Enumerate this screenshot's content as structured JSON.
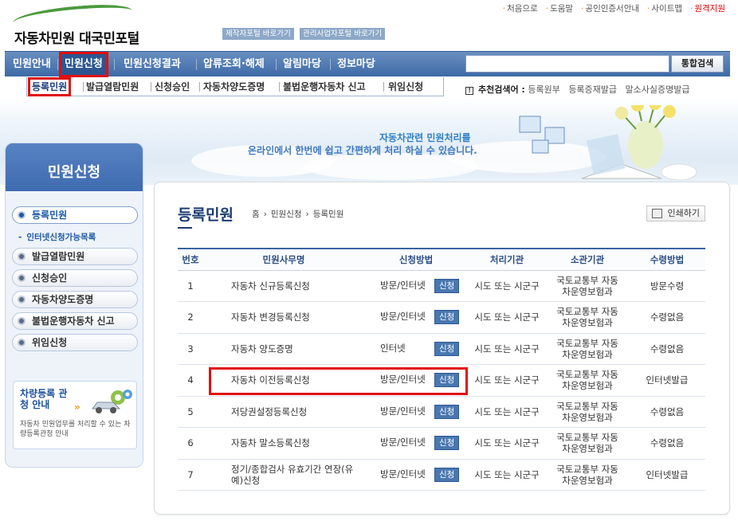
{
  "header": {
    "logo_text": "자동차민원 대국민포털",
    "quick_links": [
      "제작자포털 바로가기",
      "관리사업자포털 바로가기"
    ],
    "util_links": [
      "처음으로",
      "도움말",
      "공인인증서안내",
      "사이트맵",
      "원격지원"
    ]
  },
  "gnb": {
    "items": [
      "민원안내",
      "민원신청",
      "민원신청결과",
      "압류조회·해제",
      "알림마당",
      "정보마당"
    ],
    "search_placeholder": "",
    "search_button": "통합검색"
  },
  "lnb": {
    "items": [
      "등록민원",
      "발급열람민원",
      "신청승인",
      "자동차양도증명",
      "불법운행자동차 신고",
      "위임신청"
    ]
  },
  "recommend": {
    "label": "추천검색어 :",
    "keywords": [
      "등록원부",
      "등록증재발급",
      "말소사실증명발급"
    ]
  },
  "banner": {
    "line1": "자동차관련 민원처리를",
    "line2": "온라인에서 한번에 쉽고 간편하게 처리 하실 수 있습니다."
  },
  "left_menu": {
    "title": "민원신청",
    "items": [
      "등록민원",
      "발급열람민원",
      "신청승인",
      "자동차양도증명",
      "불법운행자동차 신고",
      "위임신청"
    ],
    "sub_item": "인터넷신청가능목록",
    "promo_title": "차량등록 관청 안내",
    "promo_desc": "자동차 민원업무를 처리할 수 있는 차량등록관청 안내"
  },
  "main": {
    "title": "등록민원",
    "breadcrumb": [
      "홈",
      "민원신청",
      "등록민원"
    ],
    "print_button": "인쇄하기",
    "columns": [
      "번호",
      "민원사무명",
      "신청방법",
      "처리기관",
      "소관기관",
      "수령방법"
    ],
    "apply_label": "신청",
    "rows": [
      {
        "no": "1",
        "name": "자동차 신규등록신청",
        "method": "방문/인터넷",
        "agency": "시도 또는 시군구",
        "owner": [
          "국토교통부 자동",
          "차운영보험과"
        ],
        "receive": "방문수령"
      },
      {
        "no": "2",
        "name": "자동차 변경등록신청",
        "method": "방문/인터넷",
        "agency": "시도 또는 시군구",
        "owner": [
          "국토교통부 자동",
          "차운영보험과"
        ],
        "receive": "수령없음"
      },
      {
        "no": "3",
        "name": "자동차 양도증명",
        "method": "인터넷",
        "agency": "시도 또는 시군구",
        "owner": [
          "국토교통부 자동",
          "차운영보험과"
        ],
        "receive": "수령없음"
      },
      {
        "no": "4",
        "name": "자동차 이전등록신청",
        "method": "방문/인터넷",
        "agency": "시도 또는 시군구",
        "owner": [
          "국토교통부 자동",
          "차운영보험과"
        ],
        "receive": "인터넷발급"
      },
      {
        "no": "5",
        "name": "저당권설정등록신청",
        "method": "방문/인터넷",
        "agency": "시도 또는 시군구",
        "owner": [
          "국토교통부 자동",
          "차운영보험과"
        ],
        "receive": "수령없음"
      },
      {
        "no": "6",
        "name": "자동차 말소등록신청",
        "method": "방문/인터넷",
        "agency": "시도 또는 시군구",
        "owner": [
          "국토교통부 자동",
          "차운영보험과"
        ],
        "receive": "수령없음"
      },
      {
        "no": "7",
        "name": [
          "정기/종합검사 유효기간 연장(유",
          "예)신청"
        ],
        "method": "방문/인터넷",
        "agency": "시도 또는 시군구",
        "owner": [
          "국토교통부 자동",
          "차운영보험과"
        ],
        "receive": "인터넷발급"
      }
    ]
  }
}
